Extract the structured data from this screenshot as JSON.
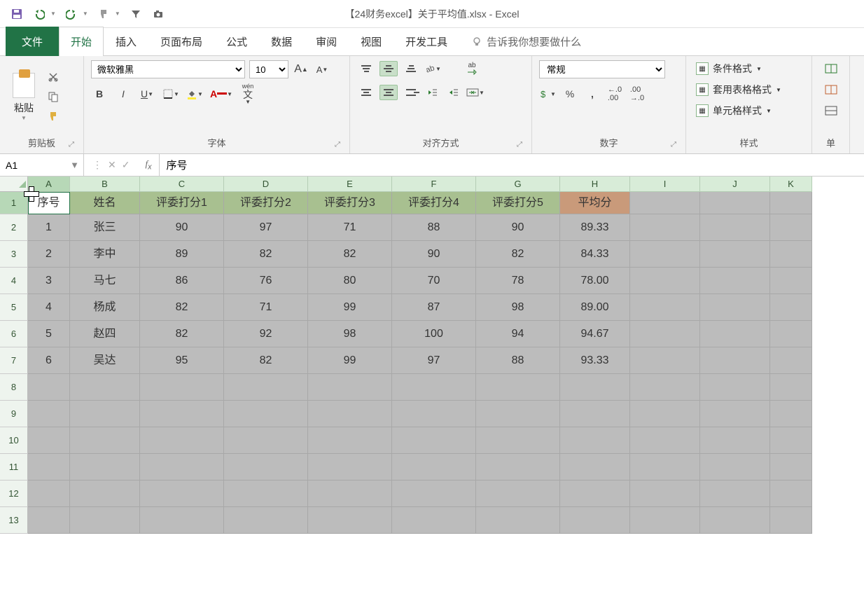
{
  "window_title": "【24财务excel】关于平均值.xlsx  -  Excel",
  "qat": {
    "save": "save",
    "undo": "undo",
    "redo": "redo",
    "brush": "brush",
    "filter": "filter",
    "camera": "camera"
  },
  "tabs": {
    "file": "文件",
    "home": "开始",
    "insert": "插入",
    "layout": "页面布局",
    "formula": "公式",
    "data": "数据",
    "review": "审阅",
    "view": "视图",
    "dev": "开发工具",
    "tell": "告诉我你想要做什么"
  },
  "ribbon": {
    "clipboard": {
      "paste": "粘贴",
      "label": "剪贴板"
    },
    "font": {
      "name": "微软雅黑",
      "size": "10",
      "label": "字体",
      "wen": "wén",
      "wen2": "文"
    },
    "align": {
      "label": "对齐方式",
      "wrap": "ab"
    },
    "number": {
      "format": "常规",
      "label": "数字"
    },
    "styles": {
      "cond": "条件格式",
      "table": "套用表格格式",
      "cell": "单元格样式",
      "label": "样式"
    },
    "cells_label": "单"
  },
  "fx": {
    "name_box": "A1",
    "formula": "序号"
  },
  "grid": {
    "col_widths": {
      "A": 60,
      "B": 100,
      "C": 120,
      "D": 120,
      "E": 120,
      "F": 120,
      "G": 120,
      "H": 100,
      "I": 100,
      "J": 100,
      "K": 60
    },
    "columns": [
      "A",
      "B",
      "C",
      "D",
      "E",
      "F",
      "G",
      "H",
      "I",
      "J",
      "K"
    ],
    "row_count": 13,
    "headers": [
      "序号",
      "姓名",
      "评委打分1",
      "评委打分2",
      "评委打分3",
      "评委打分4",
      "评委打分5",
      "平均分"
    ],
    "rows": [
      [
        "1",
        "张三",
        "90",
        "97",
        "71",
        "88",
        "90",
        "89.33"
      ],
      [
        "2",
        "李中",
        "89",
        "82",
        "82",
        "90",
        "82",
        "84.33"
      ],
      [
        "3",
        "马七",
        "86",
        "76",
        "80",
        "70",
        "78",
        "78.00"
      ],
      [
        "4",
        "杨成",
        "82",
        "71",
        "99",
        "87",
        "98",
        "89.00"
      ],
      [
        "5",
        "赵四",
        "82",
        "92",
        "98",
        "100",
        "94",
        "94.67"
      ],
      [
        "6",
        "吴达",
        "95",
        "82",
        "99",
        "97",
        "88",
        "93.33"
      ]
    ]
  }
}
